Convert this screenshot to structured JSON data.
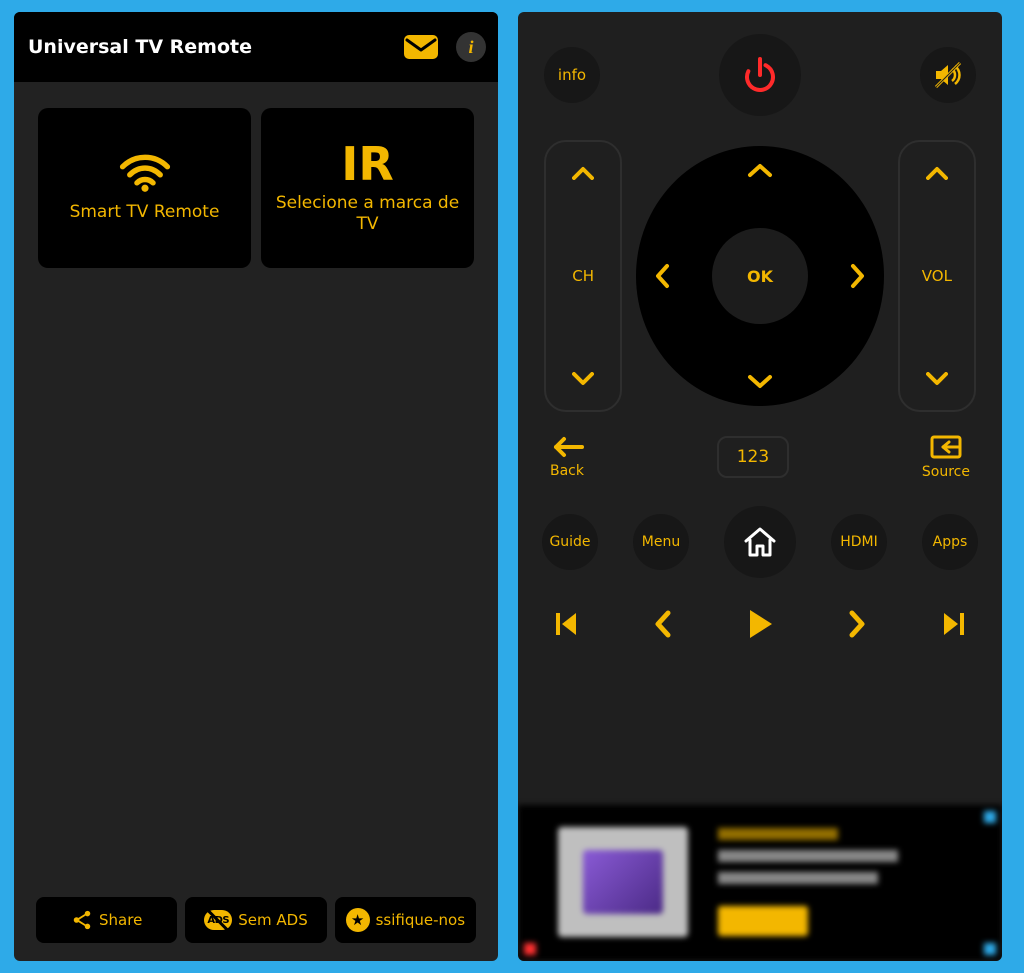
{
  "left": {
    "title": "Universal TV Remote",
    "smart_card_label": "Smart TV Remote",
    "ir_big": "IR",
    "ir_sub": "Selecione a marca de TV",
    "share": "Share",
    "noads": "Sem ADS",
    "ads_badge": "ADS",
    "rate": "ssifique-nos"
  },
  "right": {
    "info": "info",
    "ch": "CH",
    "vol": "VOL",
    "ok": "OK",
    "back": "Back",
    "numpad": "123",
    "source": "Source",
    "guide": "Guide",
    "menu": "Menu",
    "hdmi": "HDMI",
    "apps": "Apps"
  },
  "colors": {
    "accent": "#f3b700",
    "power": "#ff2a2a"
  }
}
